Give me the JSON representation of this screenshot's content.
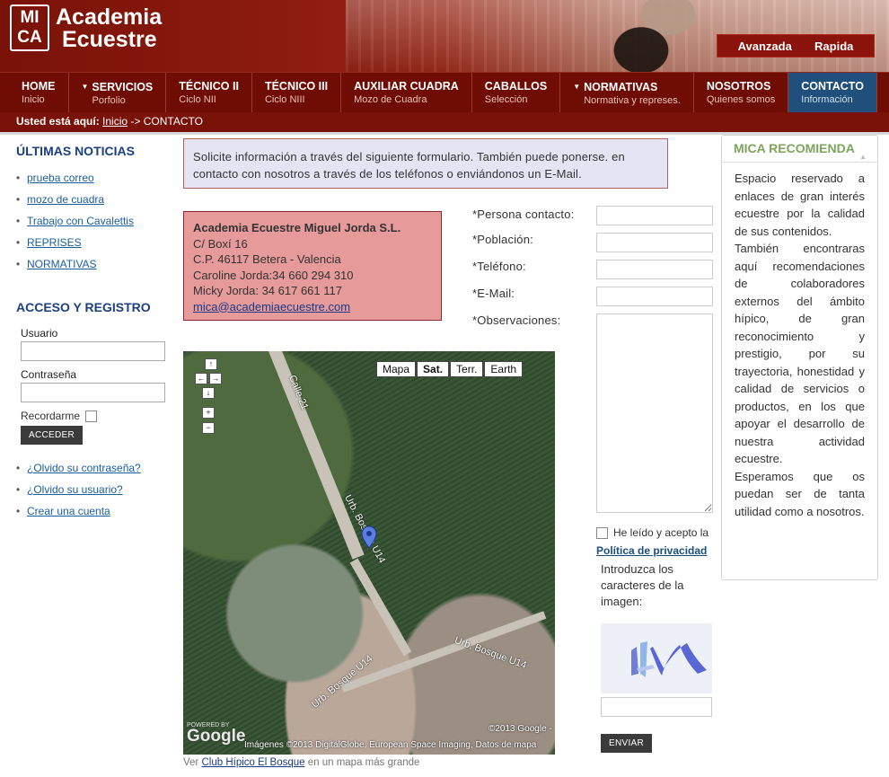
{
  "header": {
    "logo_top": "MI",
    "logo_bottom": "CA",
    "brand_line1": "Academia",
    "brand_line2": "Ecuestre",
    "search_tabs": [
      "Avanzada",
      "Rapida"
    ]
  },
  "nav": [
    {
      "title": "HOME",
      "sub": "Inicio",
      "arrow": false
    },
    {
      "title": "SERVICIOS",
      "sub": "Porfolio",
      "arrow": true
    },
    {
      "title": "TÉCNICO II",
      "sub": "Ciclo NII",
      "arrow": false
    },
    {
      "title": "TÉCNICO III",
      "sub": "Ciclo NIII",
      "arrow": false
    },
    {
      "title": "AUXILIAR CUADRA",
      "sub": "Mozo de Cuadra",
      "arrow": false
    },
    {
      "title": "CABALLOS",
      "sub": "Selección",
      "arrow": false
    },
    {
      "title": "NORMATIVAS",
      "sub": "Normativa y represes.",
      "arrow": true
    },
    {
      "title": "NOSOTROS",
      "sub": "Quienes somos",
      "arrow": false
    },
    {
      "title": "CONTACTO",
      "sub": "Información",
      "arrow": false,
      "active": true
    }
  ],
  "breadcrumb": {
    "label": "Usted está aquí:",
    "home": "Inicio",
    "sep": " -> ",
    "current": "CONTACTO"
  },
  "news": {
    "title": "ÚLTIMAS NOTICIAS",
    "items": [
      "prueba correo",
      "mozo de cuadra",
      "Trabajo con Cavalettis",
      "REPRISES",
      "NORMATIVAS"
    ]
  },
  "login": {
    "title": "ACCESO Y REGISTRO",
    "user_label": "Usuario",
    "pass_label": "Contraseña",
    "remember_label": "Recordarme",
    "button": "ACCEDER",
    "links": [
      "¿Olvido su contraseña?",
      "¿Olvido su usuario?",
      "Crear una cuenta"
    ]
  },
  "notice": "Solicite información a través del siguiente formulario. También puede ponerse. en contacto con nosotros a través de los teléfonos o enviándonos un E-Mail.",
  "company": {
    "name": "Academia Ecuestre Miguel Jorda S.L.",
    "address1": "C/ Boxí 16",
    "address2": "C.P. 46117 Betera - Valencia",
    "phone1": "Caroline Jorda:34 660 294 310",
    "phone2": "Micky Jorda: 34 617 661 117",
    "email": "mica@academiaecuestre.com"
  },
  "map": {
    "types": [
      "Mapa",
      "Sat.",
      "Terr.",
      "Earth"
    ],
    "selected": "Sat.",
    "street_labels": [
      "Calle 21",
      "Urb. Bosque U14",
      "Urb. Bosque U14",
      "Urb. Bosque U14"
    ],
    "google": "Google",
    "powered_by": "POWERED BY",
    "copyright1": "©2013 Google -",
    "copyright2": "Imágenes ©2013 DigitalGlobe, European Space Imaging, Datos de mapa",
    "caption_prefix": "Ver",
    "caption_link": "Club Hípico El Bosque",
    "caption_suffix": "en un mapa más grande"
  },
  "form": {
    "contact_label": "*Persona contacto:",
    "city_label": "*Población:",
    "phone_label": "*Teléfono:",
    "email_label": "*E-Mail:",
    "obs_label": "*Observaciones:",
    "privacy_text": "He leído y acepto la",
    "privacy_link": "Política de privacidad",
    "captcha_text": "Introduzca los caracteres de la imagen:",
    "send_button": "ENVIAR"
  },
  "recommend": {
    "title": "MICA RECOMIENDA",
    "p1": "Espacio reservado a enlaces de gran interés ecuestre por la calidad de sus contenidos.",
    "p2": "También encontraras aquí recomendaciones de colaboradores externos del ámbito hípico, de gran reconocimiento y prestigio, por su trayectoria, honestidad y calidad de servicios o productos, en los que apoyar el desarrollo de nuestra actividad ecuestre.",
    "p3": "Esperamos que os puedan ser de tanta utilidad como a nosotros."
  }
}
